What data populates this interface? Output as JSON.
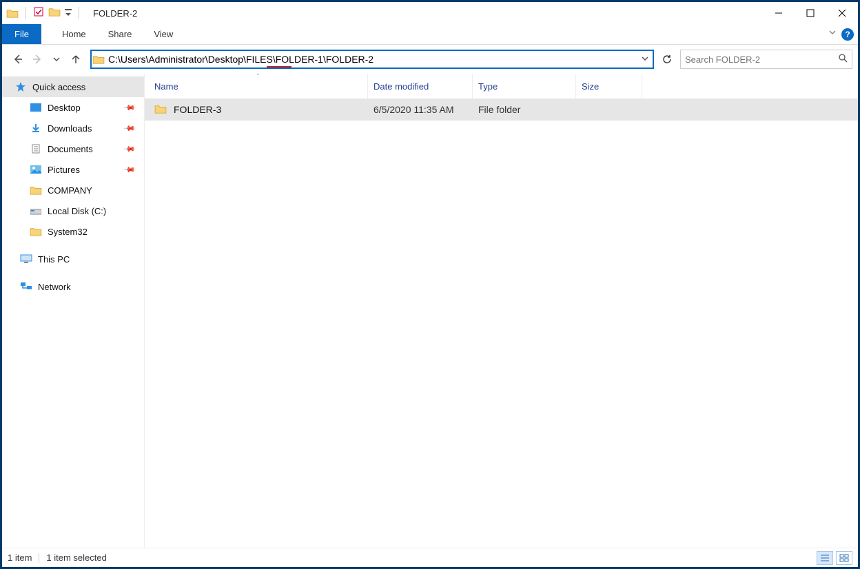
{
  "title_bar": {
    "title": "FOLDER-2",
    "separator": "|"
  },
  "ribbon": {
    "file": "File",
    "tabs": [
      "Home",
      "Share",
      "View"
    ]
  },
  "address_bar": {
    "path": "C:\\Users\\Administrator\\Desktop\\FILES\\FOLDER-1\\FOLDER-2"
  },
  "search": {
    "placeholder": "Search FOLDER-2"
  },
  "nav_pane": {
    "quick": "Quick access",
    "items": [
      {
        "label": "Desktop",
        "pinned": true,
        "icon": "desktop"
      },
      {
        "label": "Downloads",
        "pinned": true,
        "icon": "downloads"
      },
      {
        "label": "Documents",
        "pinned": true,
        "icon": "documents"
      },
      {
        "label": "Pictures",
        "pinned": true,
        "icon": "pictures"
      },
      {
        "label": "COMPANY",
        "pinned": false,
        "icon": "folder"
      },
      {
        "label": "Local Disk (C:)",
        "pinned": false,
        "icon": "disk"
      },
      {
        "label": "System32",
        "pinned": false,
        "icon": "folder"
      }
    ],
    "this_pc": "This PC",
    "network": "Network"
  },
  "columns": {
    "name": "Name",
    "date": "Date modified",
    "type": "Type",
    "size": "Size"
  },
  "rows": [
    {
      "name": "FOLDER-3",
      "date": "6/5/2020 11:35 AM",
      "type": "File folder",
      "size": ""
    }
  ],
  "status": {
    "count": "1 item",
    "selection": "1 item selected"
  },
  "icons": {
    "help": "?",
    "pin": "📌",
    "sort_asc": "ˆ"
  }
}
